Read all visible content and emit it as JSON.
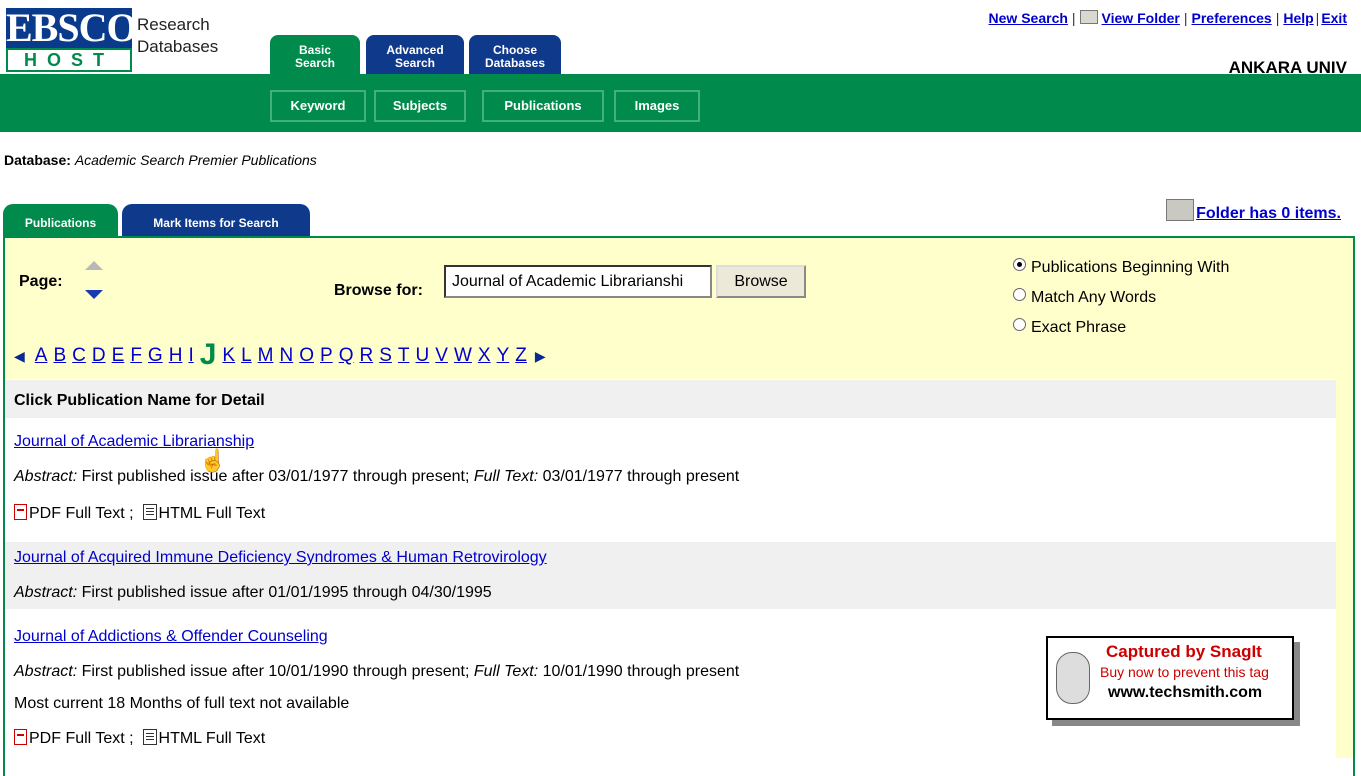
{
  "header": {
    "logo_top": "EBSCO",
    "logo_bottom": "HOST",
    "logo_line1": "Research",
    "logo_line2": "Databases",
    "links": {
      "new_search": "New Search",
      "view_folder": "View Folder",
      "preferences": "Preferences",
      "help": "Help",
      "exit": "Exit"
    },
    "institution": "ANKARA UNIV"
  },
  "main_tabs": {
    "basic": [
      "Basic",
      "Search"
    ],
    "advanced": [
      "Advanced",
      "Search"
    ],
    "choose": [
      "Choose",
      "Databases"
    ]
  },
  "sub_tabs": {
    "keyword": "Keyword",
    "subjects": "Subjects",
    "publications": "Publications",
    "images": "Images"
  },
  "database": {
    "label": "Database:",
    "name": "Academic Search Premier Publications"
  },
  "panel_tabs": {
    "publications": "Publications",
    "mark_items": "Mark Items for Search"
  },
  "folder_status": "Folder has 0 items.",
  "browse": {
    "page_label": "Page:",
    "label": "Browse for:",
    "value": "Journal of Academic Librarianshi",
    "button": "Browse",
    "options": [
      "Publications Beginning With",
      "Match Any Words",
      "Exact Phrase"
    ],
    "selected_option": "Publications Beginning With"
  },
  "alphabet": {
    "before": [
      "A",
      "B",
      "C",
      "D",
      "E",
      "F",
      "G",
      "H",
      "I"
    ],
    "current": "J",
    "after": [
      "K",
      "L",
      "M",
      "N",
      "O",
      "P",
      "Q",
      "R",
      "S",
      "T",
      "U",
      "V",
      "W",
      "X",
      "Y",
      "Z"
    ]
  },
  "results_header": "Click Publication Name for Detail",
  "results": [
    {
      "title": "Journal of Academic Librarianship",
      "abstract_label": "Abstract:",
      "abstract_text": "First published issue after 03/01/1977 through present;",
      "fulltext_label": "Full Text:",
      "fulltext_text": "03/01/1977 through present",
      "formats": "PDF Full Text ;  HTML Full Text"
    },
    {
      "title": "Journal of Acquired Immune Deficiency Syndromes & Human Retrovirology",
      "abstract_label": "Abstract:",
      "abstract_text": "First published issue after 01/01/1995 through 04/30/1995"
    },
    {
      "title": "Journal of Addictions & Offender Counseling",
      "abstract_label": "Abstract:",
      "abstract_text": "First published issue after 10/01/1990 through present;",
      "fulltext_label": "Full Text:",
      "fulltext_text": "10/01/1990 through present",
      "note": "Most current 18 Months of full text not available",
      "formats": "PDF Full Text ;  HTML Full Text"
    }
  ],
  "snagit": {
    "line1": "Captured by SnagIt",
    "line2": "Buy now to prevent this tag",
    "line3": "www.techsmith.com"
  }
}
